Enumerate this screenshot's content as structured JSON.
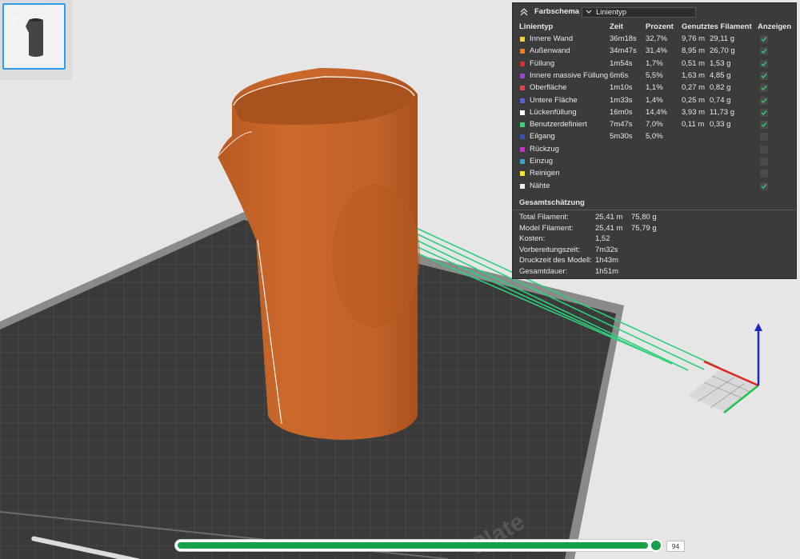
{
  "thumbnail": {
    "number": "1"
  },
  "panel": {
    "scheme_title": "Farbschema",
    "scheme_value": "Linientyp",
    "headers": {
      "name": "Linientyp",
      "time": "Zeit",
      "percent": "Prozent",
      "filament": "Genutztes Filament",
      "show": "Anzeigen"
    },
    "rows": [
      {
        "name": "Innere Wand",
        "color": "#f0d33c",
        "time": "36m18s",
        "percent": "32,7%",
        "meters": "9,76 m",
        "grams": "29,11 g",
        "checked": true
      },
      {
        "name": "Außenwand",
        "color": "#f07b2c",
        "time": "34m47s",
        "percent": "31,4%",
        "meters": "8,95 m",
        "grams": "26,70 g",
        "checked": true
      },
      {
        "name": "Füllung",
        "color": "#c8362e",
        "time": "1m54s",
        "percent": "1,7%",
        "meters": "0,51 m",
        "grams": "1,53 g",
        "checked": true
      },
      {
        "name": "Innere massive Füllung",
        "color": "#9547c9",
        "time": "6m6s",
        "percent": "5,5%",
        "meters": "1,63 m",
        "grams": "4,85 g",
        "checked": true
      },
      {
        "name": "Oberfläche",
        "color": "#e0454d",
        "time": "1m10s",
        "percent": "1,1%",
        "meters": "0,27 m",
        "grams": "0,82 g",
        "checked": true
      },
      {
        "name": "Untere Fläche",
        "color": "#5a63d6",
        "time": "1m33s",
        "percent": "1,4%",
        "meters": "0,25 m",
        "grams": "0,74 g",
        "checked": true
      },
      {
        "name": "Lückenfüllung",
        "color": "#ffffff",
        "time": "16m0s",
        "percent": "14,4%",
        "meters": "3,93 m",
        "grams": "11,73 g",
        "checked": true
      },
      {
        "name": "Benutzerdefiniert",
        "color": "#3ccf7a",
        "time": "7m47s",
        "percent": "7,0%",
        "meters": "0,11 m",
        "grams": "0,33 g",
        "checked": true
      },
      {
        "name": "Eilgang",
        "color": "#3d4fa8",
        "time": "5m30s",
        "percent": "5,0%",
        "meters": "",
        "grams": "",
        "checked": false
      },
      {
        "name": "Rückzug",
        "color": "#c930c9",
        "time": "",
        "percent": "",
        "meters": "",
        "grams": "",
        "checked": false
      },
      {
        "name": "Einzug",
        "color": "#3fa0c8",
        "time": "",
        "percent": "",
        "meters": "",
        "grams": "",
        "checked": false
      },
      {
        "name": "Reinigen",
        "color": "#f3e627",
        "time": "",
        "percent": "",
        "meters": "",
        "grams": "",
        "checked": false
      },
      {
        "name": "Nähte",
        "color": "#eeeeee",
        "time": "",
        "percent": "",
        "meters": "",
        "grams": "",
        "checked": true
      }
    ],
    "summary_title": "Gesamtschätzung",
    "summary": [
      {
        "label": "Total Filament:",
        "v1": "25,41 m",
        "v2": "75,80 g"
      },
      {
        "label": "Model Filament:",
        "v1": "25,41 m",
        "v2": "75,79 g"
      },
      {
        "label": "Kosten:",
        "v1": "1,52",
        "v2": ""
      },
      {
        "label": "Vorbereitungszeit:",
        "v1": "7m32s",
        "v2": ""
      },
      {
        "label": "Druckzeit des Modell:",
        "v1": "1h43m",
        "v2": ""
      },
      {
        "label": "Gesamtdauer:",
        "v1": "1h51m",
        "v2": ""
      }
    ]
  },
  "bed": {
    "plate_text": "Plate"
  },
  "slider": {
    "value": "94",
    "progress": 0.98
  },
  "colors": {
    "model": "#c4642a",
    "plate": "#3a3a3a",
    "accent_green": "#19a04a"
  }
}
